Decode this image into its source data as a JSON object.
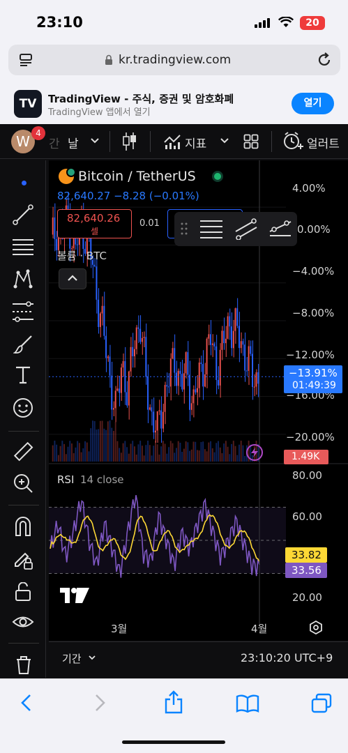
{
  "status": {
    "time": "23:10",
    "battery": "20"
  },
  "browser": {
    "url": "kr.tradingview.com"
  },
  "banner": {
    "logo_text": "TV",
    "title": "TradingView - 주식, 증권 및 암호화폐",
    "subtitle": "TradingView 앱에서 열기",
    "open_label": "열기"
  },
  "toolbar": {
    "avatar_letter": "W",
    "notifications": "4",
    "interval_partial": "간",
    "interval": "날",
    "indicators_label": "지표",
    "alerts_label": "얼러트"
  },
  "chart": {
    "symbol": "Bitcoin / TetherUS",
    "ohlc": "82,640.27  −8.28 (−0.01%)",
    "sell_price": "82,640.26",
    "sell_label": "셀",
    "spread": "0.01",
    "volume_label": "볼륨 · BTC",
    "price_axis": [
      "4.00%",
      "0.00%",
      "−4.00%",
      "−8.00%",
      "−12.00%",
      "−16.00%",
      "−20.00%"
    ],
    "current_pct": "−13.91%",
    "countdown": "01:49:39",
    "volume_value": "1.49K",
    "rsi_title": "RSI",
    "rsi_params": "14 close",
    "rsi_axis": [
      "80.00",
      "60.00",
      "20.00"
    ],
    "rsi_value": "33.82",
    "rsi_ma_value": "33.56",
    "time_axis": [
      "3월",
      "4월"
    ],
    "period_label": "기간",
    "clock": "23:10:20 UTC+9",
    "colors": {
      "up": "#ef5350",
      "down": "#2962ff",
      "rsi": "#7e57c2",
      "rsi_ma": "#fdd835",
      "badge": "#2979ff"
    }
  },
  "chart_data": {
    "type": "line",
    "title": "Bitcoin / TetherUS",
    "ylabel": "",
    "ylim": [
      -22,
      6
    ],
    "series": [
      {
        "values": [
          0,
          2,
          1,
          3,
          -1,
          2,
          1,
          -2,
          -6,
          -10,
          -14,
          -18,
          -12,
          -16,
          -10,
          -8,
          -14,
          -18,
          -20,
          -16,
          -14,
          -12,
          -15,
          -13,
          -17,
          -14,
          -12,
          -10,
          -13,
          -11,
          -8,
          -9,
          -10,
          -12,
          -14,
          -13.91
        ]
      }
    ],
    "rsi": {
      "name": "RSI",
      "ylim": [
        10,
        90
      ],
      "values": [
        45,
        60,
        40,
        55,
        75,
        50,
        35,
        60,
        45,
        30,
        55,
        78,
        42,
        38,
        65,
        50,
        35,
        55,
        45,
        60,
        72,
        55,
        40,
        50,
        62,
        48,
        35,
        33.82
      ]
    }
  },
  "nav": {
    "icons": [
      "back-icon",
      "forward-icon",
      "share-icon",
      "bookmarks-icon",
      "tabs-icon"
    ]
  }
}
